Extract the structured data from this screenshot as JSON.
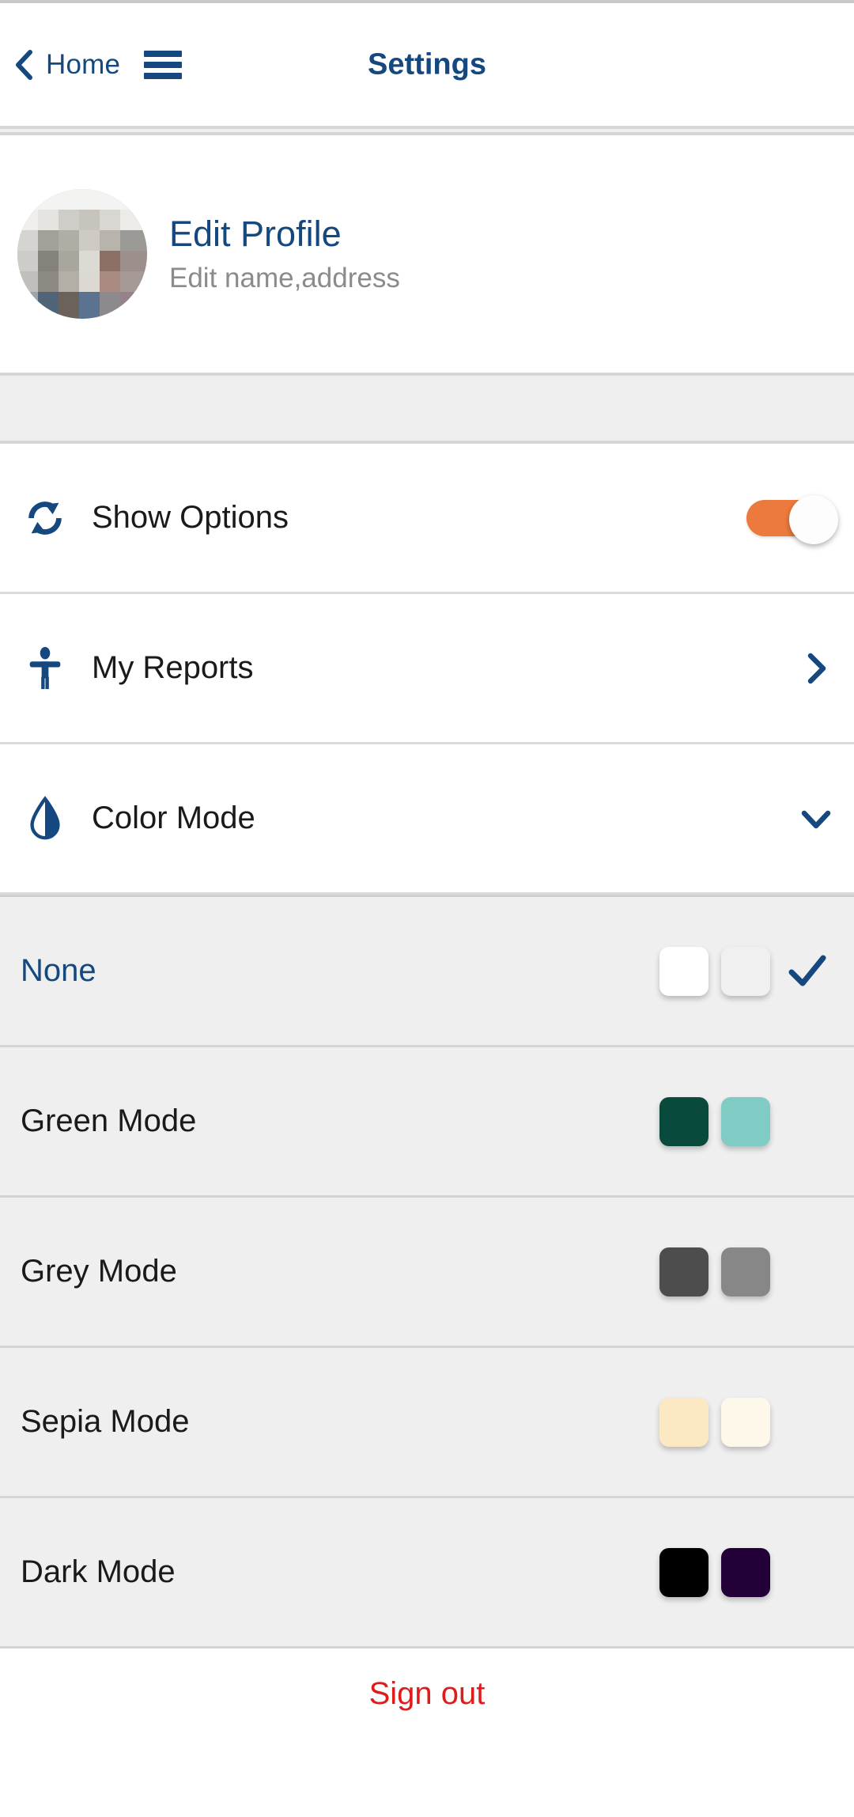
{
  "header": {
    "back_label": "Home",
    "title": "Settings",
    "back_icon": "chevron-left-icon",
    "menu_icon": "hamburger-menu-icon"
  },
  "profile": {
    "title": "Edit Profile",
    "subtitle": "Edit name,address",
    "avatar_icon": "user-avatar-photo"
  },
  "settings_rows": [
    {
      "label": "Show Options",
      "icon": "sync-refresh-icon",
      "control": "toggle",
      "toggle_state": "on",
      "toggle_on_color": "#ec7a3c"
    },
    {
      "label": "My Reports",
      "icon": "accessibility-person-icon",
      "control": "chevron-right-icon"
    },
    {
      "label": "Color Mode",
      "icon": "contrast-droplet-icon",
      "control": "chevron-down-icon"
    }
  ],
  "color_modes": [
    {
      "label": "None",
      "selected": true,
      "swatches": [
        "#ffffff",
        "#f0f0f0"
      ]
    },
    {
      "label": "Green Mode",
      "selected": false,
      "swatches": [
        "#0a4a3c",
        "#80ccc4"
      ]
    },
    {
      "label": "Grey Mode",
      "selected": false,
      "swatches": [
        "#4d4d4d",
        "#878787"
      ]
    },
    {
      "label": "Sepia Mode",
      "selected": false,
      "swatches": [
        "#fce9c3",
        "#fdf8ea"
      ]
    },
    {
      "label": "Dark Mode",
      "selected": false,
      "swatches": [
        "#000000",
        "#230038"
      ]
    }
  ],
  "footer": {
    "signout_label": "Sign out",
    "signout_color": "#e01b1b"
  },
  "theme": {
    "accent_blue": "#14487e",
    "band_bg": "#efefef",
    "band_border": "#d6d6d6"
  }
}
